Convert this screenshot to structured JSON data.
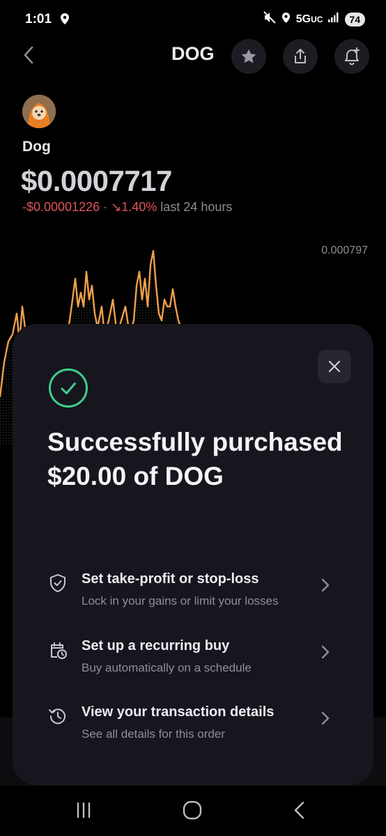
{
  "status_bar": {
    "time": "1:01",
    "network": "5G",
    "network_suffix": "UC",
    "battery": "74"
  },
  "header": {
    "title": "DOG",
    "icons": [
      "back-chevron-icon",
      "star-icon",
      "share-icon",
      "bell-plus-icon"
    ]
  },
  "coin": {
    "name": "Dog",
    "price": "$0.0007717",
    "change_amount": "-$0.00001226",
    "separator": "·",
    "change_arrow": "↘",
    "change_percent": "1.40%",
    "period": "last 24 hours",
    "chart_high_label": "0.000797"
  },
  "sheet": {
    "headline": "Successfully purchased $20.00 of DOG",
    "options": [
      {
        "title": "Set take-profit or stop-loss",
        "subtitle": "Lock in your gains or limit your losses",
        "icon": "shield-check-icon"
      },
      {
        "title": "Set up a recurring buy",
        "subtitle": "Buy automatically on a schedule",
        "icon": "calendar-clock-icon"
      },
      {
        "title": "View your transaction details",
        "subtitle": "See all details for this order",
        "icon": "history-icon"
      }
    ]
  },
  "colors": {
    "accent_green": "#3ecf8e",
    "negative_red": "#e0545a",
    "chart_orange": "#f0a04b",
    "sheet_bg": "#17161e"
  }
}
